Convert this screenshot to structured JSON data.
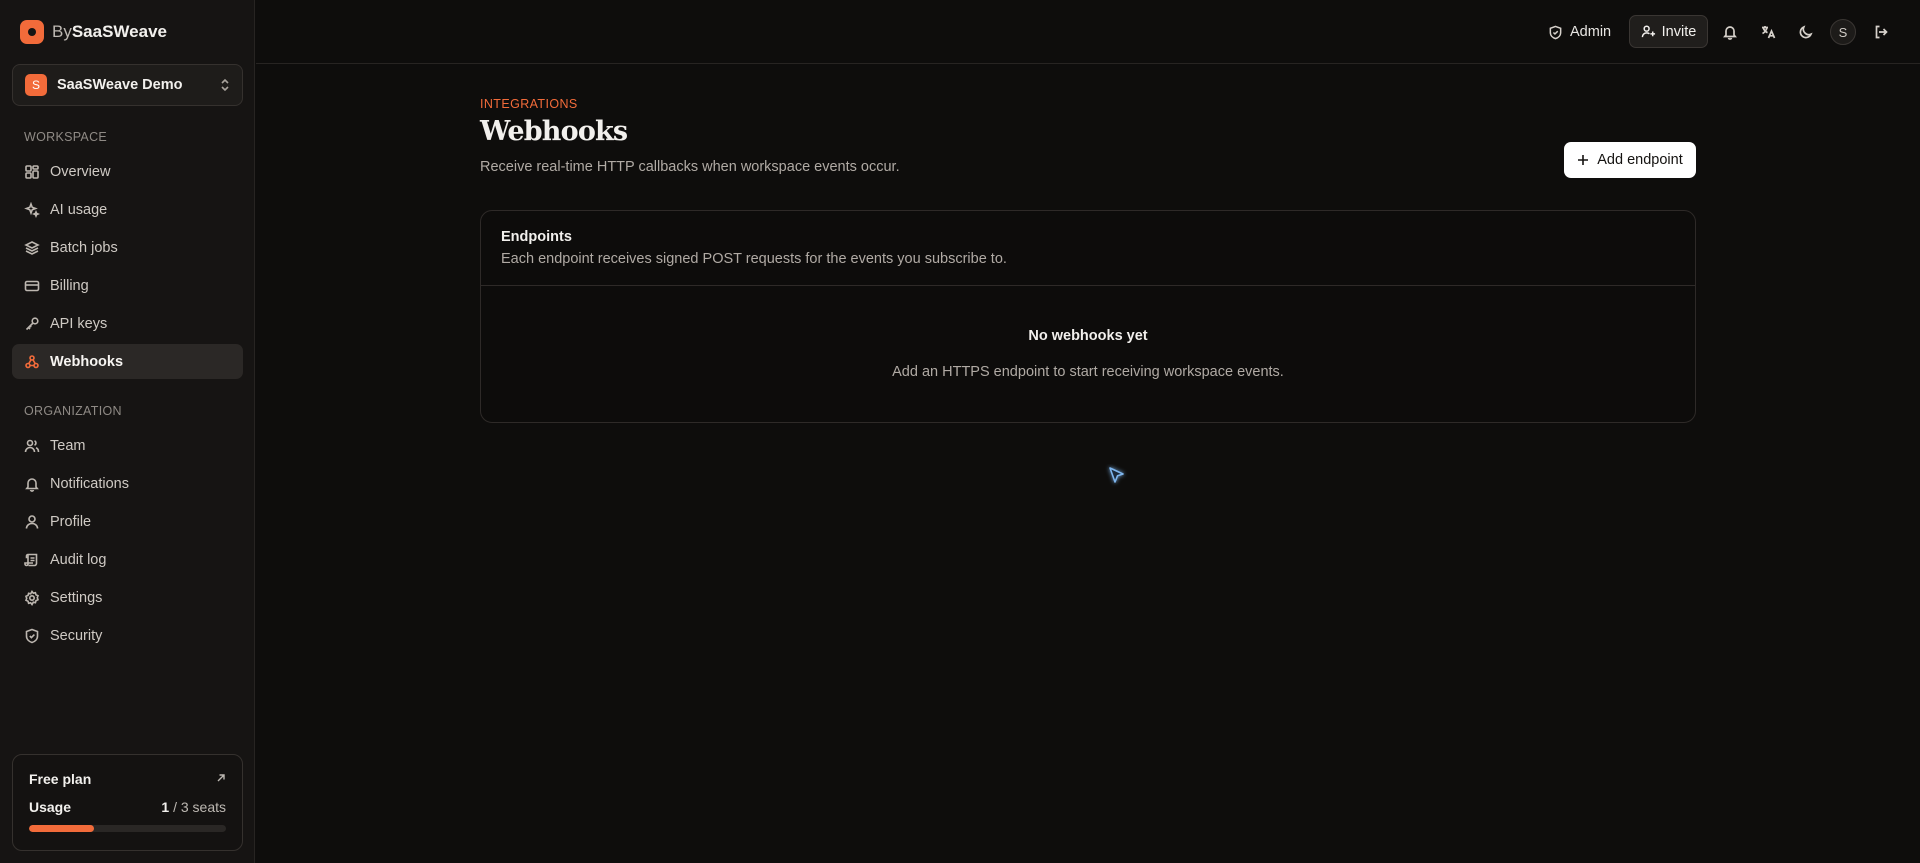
{
  "brand": {
    "prefix": "By",
    "name": "SaaSWeave"
  },
  "workspace": {
    "initial": "S",
    "name": "SaaSWeave Demo"
  },
  "sidebar": {
    "workspace_label": "WORKSPACE",
    "workspace_items": [
      {
        "label": "Overview",
        "icon": "grid-icon"
      },
      {
        "label": "AI usage",
        "icon": "sparkles-icon"
      },
      {
        "label": "Batch jobs",
        "icon": "layers-icon"
      },
      {
        "label": "Billing",
        "icon": "credit-card-icon"
      },
      {
        "label": "API keys",
        "icon": "key-icon"
      },
      {
        "label": "Webhooks",
        "icon": "webhook-icon",
        "active": true
      }
    ],
    "organization_label": "ORGANIZATION",
    "organization_items": [
      {
        "label": "Team",
        "icon": "users-icon"
      },
      {
        "label": "Notifications",
        "icon": "bell-icon"
      },
      {
        "label": "Profile",
        "icon": "user-icon"
      },
      {
        "label": "Audit log",
        "icon": "scroll-icon"
      },
      {
        "label": "Settings",
        "icon": "gear-icon"
      },
      {
        "label": "Security",
        "icon": "shield-icon"
      }
    ]
  },
  "plan": {
    "title": "Free plan",
    "usage_label": "Usage",
    "seats_used": "1",
    "seats_rest": "/ 3 seats",
    "usage_fraction": 0.33,
    "accent": "#f26b3a"
  },
  "topbar": {
    "admin_label": "Admin",
    "invite_label": "Invite",
    "avatar_initial": "S",
    "icons": [
      "bell-icon",
      "translate-icon",
      "moon-icon",
      "logout-icon"
    ]
  },
  "page": {
    "eyebrow": "INTEGRATIONS",
    "title": "Webhooks",
    "subtitle": "Receive real-time HTTP callbacks when workspace events occur.",
    "add_button": "Add endpoint"
  },
  "endpoints_card": {
    "title": "Endpoints",
    "description": "Each endpoint receives signed POST requests for the events you subscribe to.",
    "empty_title": "No webhooks yet",
    "empty_description": "Add an HTTPS endpoint to start receiving workspace events."
  }
}
